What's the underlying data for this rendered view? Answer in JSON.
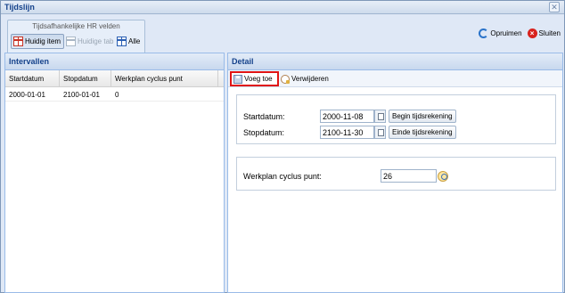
{
  "window": {
    "title": "Tijdslijn"
  },
  "toolbar": {
    "group_title": "Tijdsafhankelijke HR velden",
    "huidig_item": "Huidig item",
    "huidige_tab": "Huidige tab",
    "alle": "Alle",
    "opruimen": "Opruimen",
    "sluiten": "Sluiten"
  },
  "intervals": {
    "title": "Intervallen",
    "columns": [
      "Startdatum",
      "Stopdatum",
      "Werkplan cyclus punt"
    ],
    "rows": [
      [
        "2000-01-01",
        "2100-01-01",
        "0"
      ]
    ]
  },
  "detail": {
    "title": "Detail",
    "add_label": "Voeg toe",
    "delete_label": "Verwijderen",
    "start_label": "Startdatum:",
    "start_value": "2000-11-08",
    "start_button": "Begin tijdsrekening",
    "stop_label": "Stopdatum:",
    "stop_value": "2100-11-30",
    "stop_button": "Einde tijdsrekening",
    "cycle_label": "Werkplan cyclus punt:",
    "cycle_value": "26"
  },
  "colors": {
    "highlight": "#e01414",
    "header_text": "#15428b"
  }
}
